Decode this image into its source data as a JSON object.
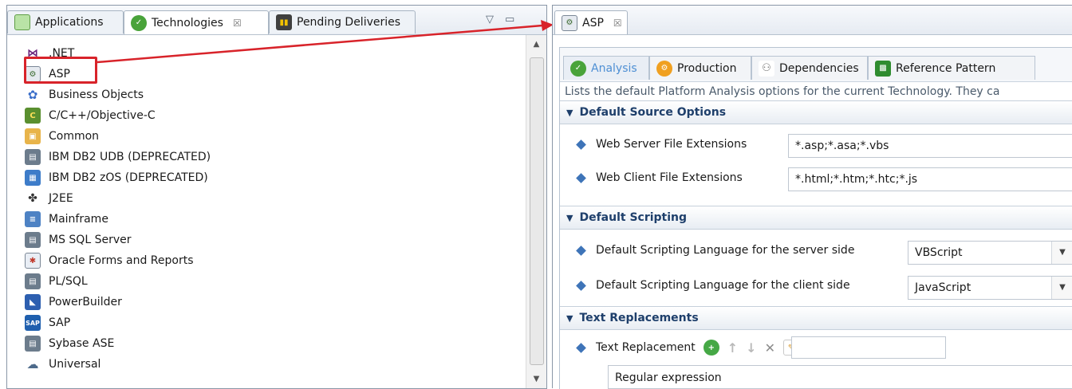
{
  "left_tabs": [
    {
      "label": "Applications",
      "icon": "folder-icon"
    },
    {
      "label": "Technologies",
      "icon": "technologies-icon",
      "close": "☒"
    },
    {
      "label": "Pending Deliveries",
      "icon": "delivery-truck-icon"
    }
  ],
  "window_controls": {
    "minimize": "▽",
    "maximize": "▭"
  },
  "technologies": [
    {
      "label": ".NET",
      "icon": "dotnet-icon"
    },
    {
      "label": "ASP",
      "icon": "asp-icon"
    },
    {
      "label": "Business Objects",
      "icon": "business-objects-icon"
    },
    {
      "label": "C/C++/Objective-C",
      "icon": "c-cpp-icon"
    },
    {
      "label": "Common",
      "icon": "common-icon"
    },
    {
      "label": "IBM DB2 UDB (DEPRECATED)",
      "icon": "database-icon"
    },
    {
      "label": "IBM DB2 zOS (DEPRECATED)",
      "icon": "db2-zos-icon"
    },
    {
      "label": "J2EE",
      "icon": "j2ee-icon"
    },
    {
      "label": "Mainframe",
      "icon": "mainframe-icon"
    },
    {
      "label": "MS SQL Server",
      "icon": "database-icon"
    },
    {
      "label": "Oracle Forms and Reports",
      "icon": "oracle-forms-icon"
    },
    {
      "label": "PL/SQL",
      "icon": "database-icon"
    },
    {
      "label": "PowerBuilder",
      "icon": "powerbuilder-icon"
    },
    {
      "label": "SAP",
      "icon": "sap-icon"
    },
    {
      "label": "Sybase ASE",
      "icon": "database-icon"
    },
    {
      "label": "Universal",
      "icon": "universal-icon"
    }
  ],
  "editor_tab": {
    "label": "ASP",
    "close": "☒"
  },
  "sub_tabs": [
    {
      "label": "Analysis",
      "icon": "analysis-icon"
    },
    {
      "label": "Production",
      "icon": "production-icon"
    },
    {
      "label": "Dependencies",
      "icon": "dependencies-icon"
    },
    {
      "label": "Reference Pattern",
      "icon": "reference-pattern-icon"
    }
  ],
  "description": "Lists the default Platform Analysis options for the current Technology. They ca",
  "sections": {
    "source_options": {
      "title": "Default Source Options",
      "web_server_label": "Web Server File Extensions",
      "web_server_value": "*.asp;*.asa;*.vbs",
      "web_client_label": "Web Client File Extensions",
      "web_client_value": "*.html;*.htm;*.htc;*.js"
    },
    "scripting": {
      "title": "Default Scripting",
      "server_label": "Default Scripting Language for the server side",
      "server_value": "VBScript",
      "client_label": "Default Scripting Language for the client side",
      "client_value": "JavaScript"
    },
    "text_replacements": {
      "title": "Text Replacements",
      "label": "Text Replacement",
      "column_header": "Regular expression"
    }
  },
  "colors": {
    "highlight": "#d8232a",
    "arrow": "#d8232a",
    "section_title": "#1e3f6b",
    "active_subtab": "#4e8fd4"
  }
}
